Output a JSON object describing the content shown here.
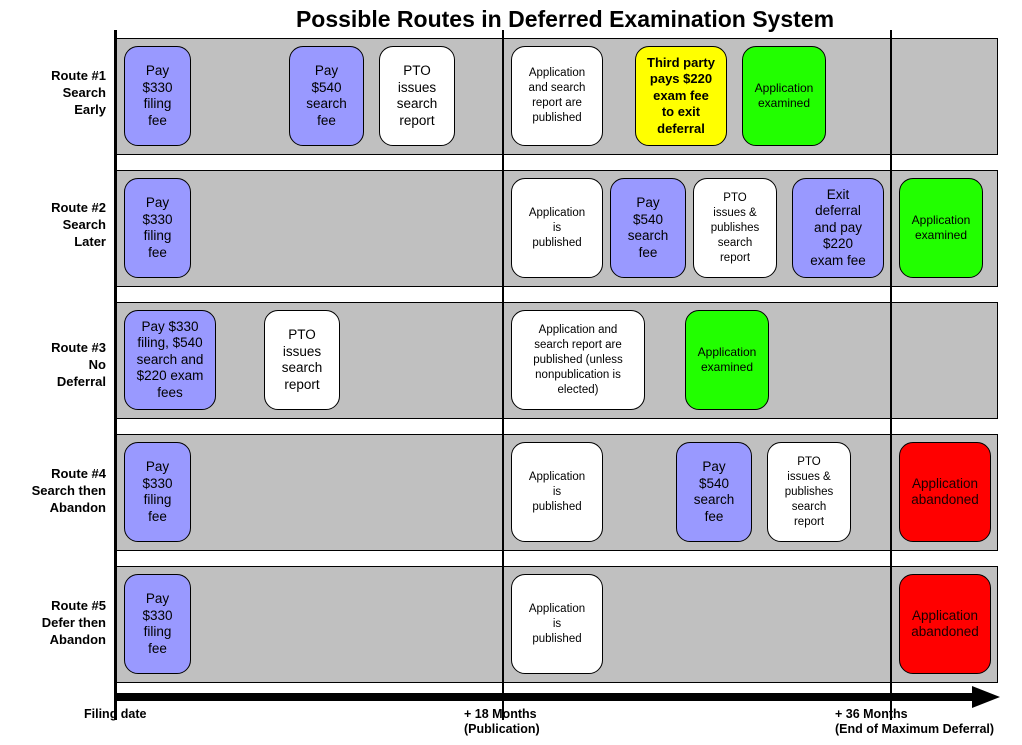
{
  "title": "Possible Routes in Deferred Examination System",
  "colors": {
    "fee_payment": "#9999ff",
    "pto_action": "#ffffff",
    "examined": "#22ff00",
    "third_party": "#ffff00",
    "abandoned": "#ff0000",
    "lane_background": "#c0c0c0"
  },
  "timeline": {
    "filing": "Filing date",
    "m18": "+ 18 Months\n(Publication)",
    "m36": "+ 36 Months\n(End of Maximum Deferral)"
  },
  "routes": [
    {
      "label": "Route #1\nSearch\nEarly",
      "steps": [
        {
          "text": "Pay\n$330\nfiling\nfee",
          "kind": "fee_payment"
        },
        {
          "text": "Pay\n$540\nsearch\nfee",
          "kind": "fee_payment"
        },
        {
          "text": "PTO\nissues\nsearch\nreport",
          "kind": "pto_action"
        },
        {
          "text": "Application\nand search\nreport are\npublished",
          "kind": "pto_action"
        },
        {
          "text": "Third party\npays $220\nexam fee\nto exit\ndeferral",
          "kind": "third_party"
        },
        {
          "text": "Application\nexamined",
          "kind": "examined"
        }
      ]
    },
    {
      "label": "Route #2\nSearch\nLater",
      "steps": [
        {
          "text": "Pay\n$330\nfiling\nfee",
          "kind": "fee_payment"
        },
        {
          "text": "Application\nis\npublished",
          "kind": "pto_action"
        },
        {
          "text": "Pay\n$540\nsearch\nfee",
          "kind": "fee_payment"
        },
        {
          "text": "PTO\nissues &\npublishes\nsearch\nreport",
          "kind": "pto_action"
        },
        {
          "text": "Exit\ndeferral\nand pay\n$220\nexam fee",
          "kind": "fee_payment"
        },
        {
          "text": "Application\nexamined",
          "kind": "examined"
        }
      ]
    },
    {
      "label": "Route #3\nNo\nDeferral",
      "steps": [
        {
          "text": "Pay $330\nfiling, $540\nsearch and\n$220 exam\nfees",
          "kind": "fee_payment"
        },
        {
          "text": "PTO\nissues\nsearch\nreport",
          "kind": "pto_action"
        },
        {
          "text": "Application and\nsearch report are\npublished (unless\nnonpublication is\nelected)",
          "kind": "pto_action"
        },
        {
          "text": "Application\nexamined",
          "kind": "examined"
        }
      ]
    },
    {
      "label": "Route #4\nSearch then\nAbandon",
      "steps": [
        {
          "text": "Pay\n$330\nfiling\nfee",
          "kind": "fee_payment"
        },
        {
          "text": "Application\nis\npublished",
          "kind": "pto_action"
        },
        {
          "text": "Pay\n$540\nsearch\nfee",
          "kind": "fee_payment"
        },
        {
          "text": "PTO\nissues &\npublishes\nsearch\nreport",
          "kind": "pto_action"
        },
        {
          "text": "Application\nabandoned",
          "kind": "abandoned"
        }
      ]
    },
    {
      "label": "Route #5\nDefer then\nAbandon",
      "steps": [
        {
          "text": "Pay\n$330\nfiling\nfee",
          "kind": "fee_payment"
        },
        {
          "text": "Application\nis\npublished",
          "kind": "pto_action"
        },
        {
          "text": "Application\nabandoned",
          "kind": "abandoned"
        }
      ]
    }
  ]
}
